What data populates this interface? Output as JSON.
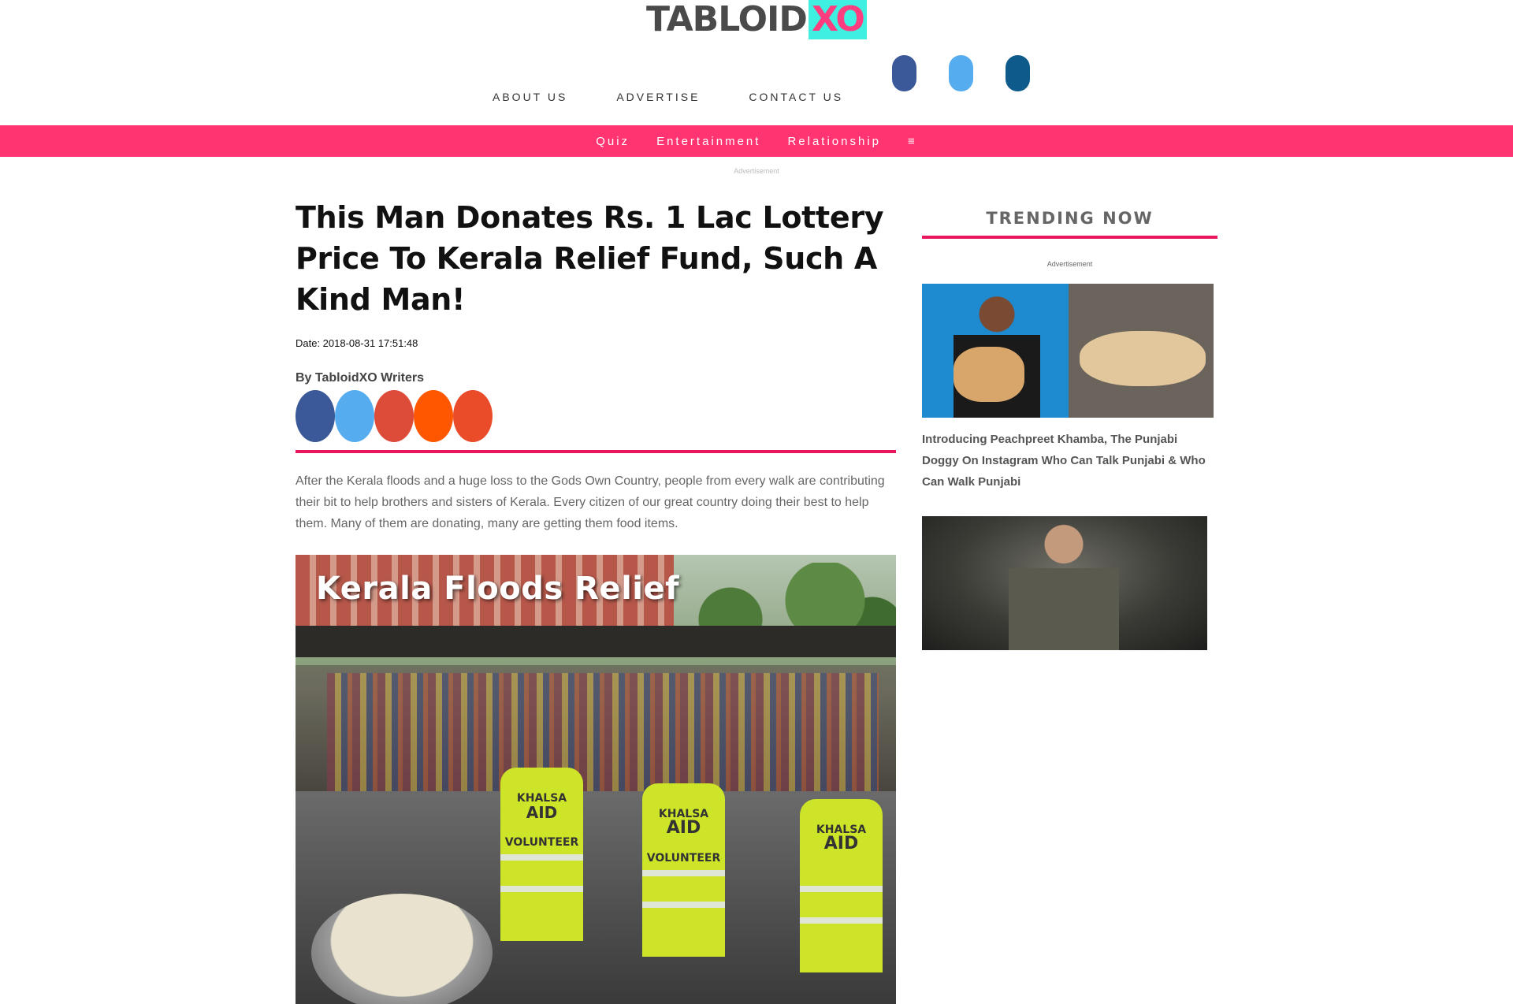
{
  "header": {
    "logo_part1": "TABLOID",
    "logo_part2": "XO",
    "nav": [
      {
        "label": "ABOUT US"
      },
      {
        "label": "ADVERTISE"
      },
      {
        "label": "CONTACT US"
      }
    ],
    "social_icons": [
      "facebook-icon",
      "twitter-icon",
      "linkedin-icon"
    ],
    "social_colors": [
      "#3b5998",
      "#55acee",
      "#0e5a8a"
    ]
  },
  "categories": {
    "items": [
      {
        "label": "Quiz"
      },
      {
        "label": "Entertainment"
      },
      {
        "label": "Relationship"
      }
    ],
    "menu_glyph": "≡"
  },
  "ads": {
    "top_label": "Advertisement",
    "side_label": "Advertisement"
  },
  "article": {
    "title": "This Man Donates Rs. 1 Lac Lottery Price To Kerala Relief Fund, Such A Kind Man!",
    "date": "Date: 2018-08-31 17:51:48",
    "byline": "By TabloidXO Writers",
    "share_colors": [
      "#3b5998",
      "#55acee",
      "#dd4b39",
      "#ff5700",
      "#ea4c2a"
    ],
    "share_icons": [
      "facebook-share-icon",
      "twitter-share-icon",
      "google-plus-share-icon",
      "reddit-share-icon",
      "stumbleupon-share-icon"
    ],
    "lead": "After the Kerala floods and a huge loss to the Gods Own Country, people from every walk are contributing their bit to help brothers and sisters of Kerala. Every citizen of our great country doing their best to help them. Many of them are donating, many are getting them food items.",
    "hero_overlay": "Kerala Floods Relief",
    "vest_text": [
      "KHALSA",
      "AID",
      "VOLUNTEER"
    ]
  },
  "sidebar": {
    "title": "TRENDING NOW",
    "cards": [
      {
        "title": "Introducing Peachpreet Khamba, The Punjabi Doggy On Instagram Who Can Talk Punjabi & Who Can Walk Punjabi"
      },
      {
        "title": ""
      }
    ]
  },
  "colors": {
    "accent": "#ff3470",
    "rule": "#e8175d",
    "logo_bg": "#3ff0e0"
  }
}
